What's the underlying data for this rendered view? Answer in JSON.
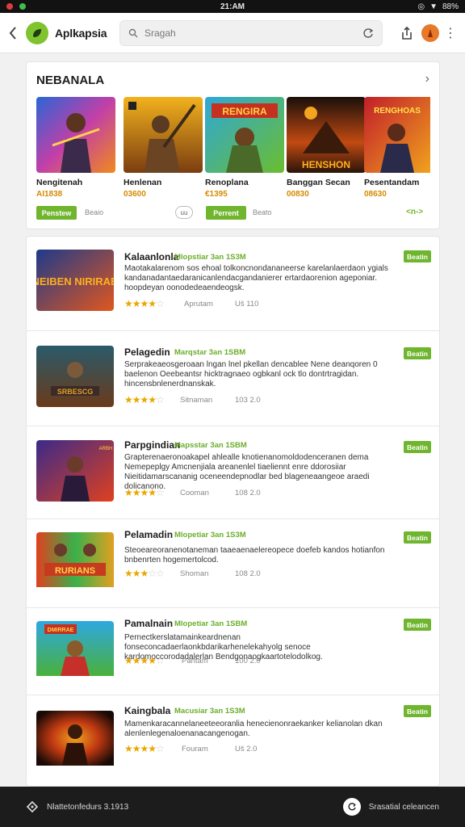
{
  "status": {
    "time": "21:AM",
    "battery": "88%"
  },
  "appbar": {
    "app_name": "Aplkapsia",
    "search_placeholder": "Sragah"
  },
  "featured": {
    "title": "NEBANALA",
    "items": [
      {
        "name": "Nengitenah",
        "price": "AI1838",
        "art": "a1"
      },
      {
        "name": "Henlenan",
        "price": "03600",
        "art": "a2"
      },
      {
        "name": "Renoplana",
        "price": "€1395",
        "art": "a3"
      },
      {
        "name": "Banggan Secan",
        "price": "00830",
        "art": "a4"
      },
      {
        "name": "Pesentandam",
        "price": "08630",
        "art": "a5"
      }
    ],
    "art_texts": {
      "a3": "RENGIRA",
      "a4": "HENSHON",
      "a5": "RENGHOAS"
    },
    "button1": "Penstew",
    "text1": "Beaio",
    "pill": "uu",
    "button2": "Perrent",
    "text2": "Beato",
    "more": "<n->"
  },
  "list": [
    {
      "name": "Kalaanlonla",
      "sub": "Mlopstiar 3an 1S3M",
      "desc": "Maotakalarenom sos ehoal tolkoncnondananeerse karelanlaerdaon ygials kandanadantaedaranicanlendacgandanierer ertardaorenion ageponiar. hoopdeyan oonodedeaendeogsk.",
      "stars": 4,
      "meta1": "Aprutam",
      "meta2": "Uš 110",
      "button": "Beatin",
      "art_text": "NEIBEN NIRIRAB"
    },
    {
      "name": "Pelagedin",
      "sub": "Marqstar 3an 1SBM",
      "desc": "Serprakeaeosgeroaan lngan lnel pkellan dencablee Nene deanqoren 0 baelenon Oeebeantsr hicktragnaeo ogbkanl ock tlo dontrtragidan. hincensbnlenerdnanskak.",
      "stars": 4,
      "meta1": "Sitnaman",
      "meta2": "103 2.0",
      "button": "Beatin",
      "art_text": "SRBESCG"
    },
    {
      "name": "Parpgindian",
      "sub": "Mapsstar 3an 1SBM",
      "desc": "Grapterenaeronoakapel ahlealle knotienanomoldodenceranen dema Nemepeplgy Amcnenjiala areanenlel tiaeliennt enre ddorosiiar Nieitidamarscananig oceneendepnodlar bed blageneaangeoe araedi dolicanono.",
      "stars": 4,
      "meta1": "Cooman",
      "meta2": "108 2.0",
      "button": "Beatin",
      "art_text": "ARBH"
    },
    {
      "name": "Pelamadin",
      "sub": "Mlopetiar 3an 1S3M",
      "desc": "Steoeareoranenotaneman taaeaenaelereopece doefeb kandos hotianfon bnbenrten hogemertolcod.",
      "stars": 3,
      "meta1": "Shoman",
      "meta2": "108 2.0",
      "button": "Beatin",
      "art_text": "RURIANS"
    },
    {
      "name": "Pamalnain",
      "sub": "Mlopetiar 3an 1SBM",
      "desc": "Pernectkerslatamainkeardnenan fonseconcadaerlaonkbdarikarhenelekahyolg senoce kardomoccorodadalerlan Bendgonaogkaartotelodolkog.",
      "stars": 4,
      "meta1": "Pantam",
      "meta2": "100 2.0",
      "button": "Beatin",
      "art_text": "DMIRRAE"
    },
    {
      "name": "Kaingbala",
      "sub": "Macusiar 3an 1S3M",
      "desc": "Mamenkaracannelaneeteeoranlia henecienonraekanker kelianolan dkan alenlenlegenaloenanacangenogan.",
      "stars": 4,
      "meta1": "Fouram",
      "meta2": "Uš 2.0",
      "button": "Beatin",
      "art_text": ""
    }
  ],
  "bottombar": {
    "left_text": "Nlattetonfedurs 3.1913",
    "right_text": "Srasatial celeancen"
  },
  "colors": {
    "accent_green": "#6fb52d",
    "price_orange": "#d68a00",
    "star_yellow": "#e9a800"
  }
}
